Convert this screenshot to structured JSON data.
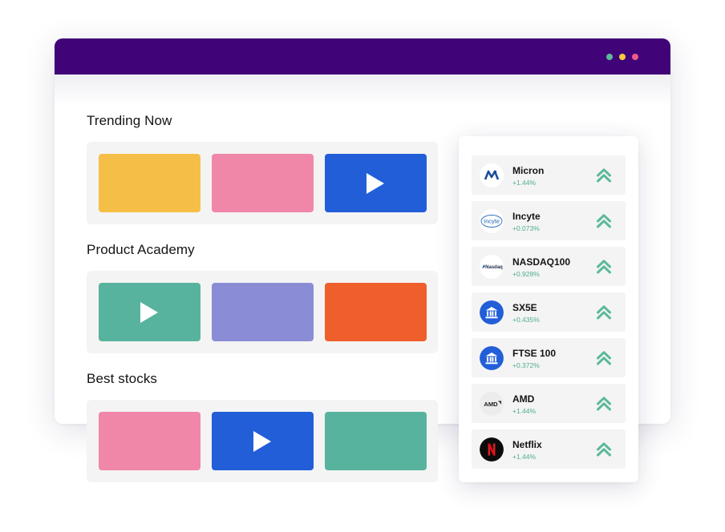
{
  "window": {
    "dots": [
      {
        "name": "green",
        "color": "#5cb99a"
      },
      {
        "name": "yellow",
        "color": "#f5cc3c"
      },
      {
        "name": "pink",
        "color": "#ef5a8a"
      }
    ],
    "titlebar_color": "#410378"
  },
  "sections": [
    {
      "title": "Trending Now",
      "tiles": [
        {
          "color": "#f5bf47",
          "has_play": false
        },
        {
          "color": "#f087a9",
          "has_play": false
        },
        {
          "color": "#225ed8",
          "has_play": true
        }
      ]
    },
    {
      "title": "Product Academy",
      "tiles": [
        {
          "color": "#58b39e",
          "has_play": true
        },
        {
          "color": "#8a8dd6",
          "has_play": false
        },
        {
          "color": "#ef5f2c",
          "has_play": false
        }
      ]
    },
    {
      "title": "Best stocks",
      "tiles": [
        {
          "color": "#f087a9",
          "has_play": false
        },
        {
          "color": "#225ed8",
          "has_play": true
        },
        {
          "color": "#58b39e",
          "has_play": false
        }
      ]
    }
  ],
  "stocks": [
    {
      "name": "Micron",
      "change": "+1.44%",
      "logo": "micron-logo-icon"
    },
    {
      "name": "Incyte",
      "change": "+0.073%",
      "logo": "incyte-logo-icon"
    },
    {
      "name": "NASDAQ100",
      "change": "+0.928%",
      "logo": "nasdaq-logo-icon"
    },
    {
      "name": "SX5E",
      "change": "+0.435%",
      "logo": "bank-icon"
    },
    {
      "name": "FTSE 100",
      "change": "+0.372%",
      "logo": "bank-icon"
    },
    {
      "name": "AMD",
      "change": "+1.44%",
      "logo": "amd-logo-icon"
    },
    {
      "name": "Netflix",
      "change": "+1.44%",
      "logo": "netflix-logo-icon"
    }
  ],
  "logo_text": {
    "incyte": "Incyte",
    "nasdaq": "Nasdaq",
    "amd": "AMD"
  },
  "colors": {
    "positive_change": "#4fae8c",
    "up_arrow": "#5cb99a",
    "bank_icon_bg": "#225ed8"
  }
}
